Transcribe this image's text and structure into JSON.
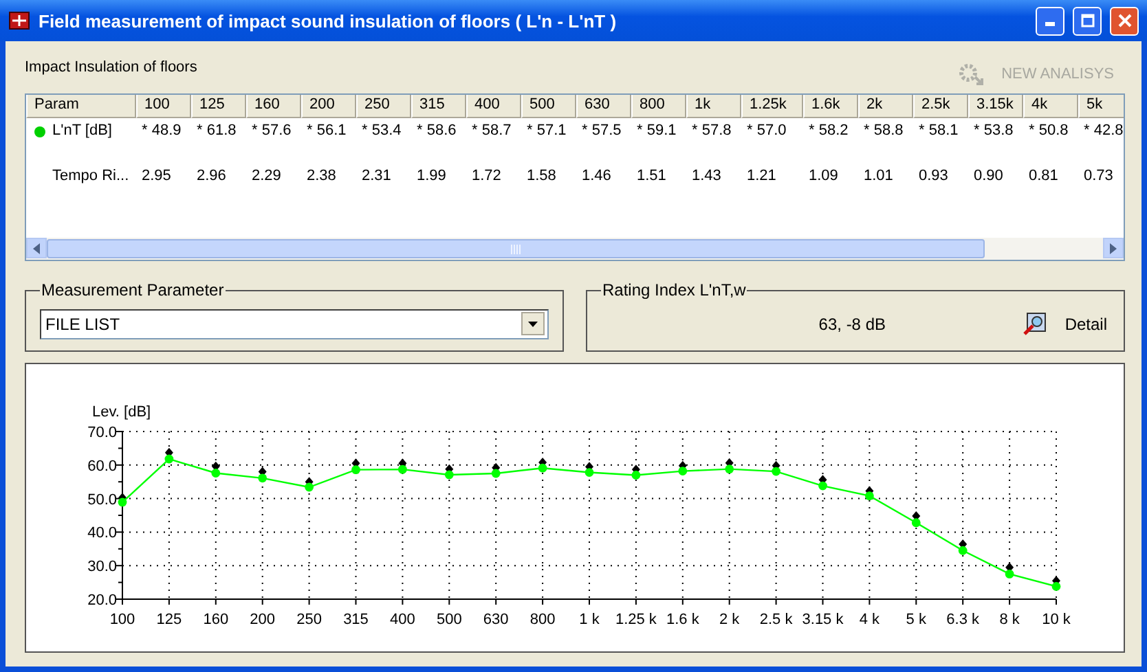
{
  "window": {
    "title": "Field measurement of impact sound insulation of floors ( L'n - L'nT )"
  },
  "section_title": "Impact Insulation of floors",
  "new_analysis_button": {
    "label": "NEW ANALISYS",
    "disabled": true
  },
  "table": {
    "columns": [
      "Param",
      "100",
      "125",
      "160",
      "200",
      "250",
      "315",
      "400",
      "500",
      "630",
      "800",
      "1k",
      "1.25k",
      "1.6k",
      "2k",
      "2.5k",
      "3.15k",
      "4k",
      "5k"
    ],
    "rows": [
      {
        "indicator": true,
        "cells": [
          "L'nT [dB]",
          "* 48.9",
          "* 61.8",
          "* 57.6",
          "* 56.1",
          "* 53.4",
          "* 58.6",
          "* 58.7",
          "* 57.1",
          "* 57.5",
          "* 59.1",
          "* 57.8",
          "* 57.0",
          "* 58.2",
          "* 58.8",
          "* 58.1",
          "* 53.8",
          "* 50.8",
          "* 42.8"
        ]
      },
      {
        "indicator": false,
        "cells": [
          "Tempo Ri...",
          "2.95",
          "2.96",
          "2.29",
          "2.38",
          "2.31",
          "1.99",
          "1.72",
          "1.58",
          "1.46",
          "1.51",
          "1.43",
          "1.21",
          "1.09",
          "1.01",
          "0.93",
          "0.90",
          "0.81",
          "0.73"
        ]
      }
    ]
  },
  "measurement_parameter": {
    "legend": "Measurement Parameter",
    "value": "FILE LIST"
  },
  "rating_index": {
    "legend": "Rating Index  L'nT,w",
    "value": "63, -8  dB",
    "detail_button": "Detail"
  },
  "chart": {
    "chart_data": {
      "type": "line",
      "ylabel": "Lev. [dB]",
      "categories": [
        "100",
        "125",
        "160",
        "200",
        "250",
        "315",
        "400",
        "500",
        "630",
        "800",
        "1 k",
        "1.25 k",
        "1.6 k",
        "2 k",
        "2.5 k",
        "3.15 k",
        "4 k",
        "5 k",
        "6.3 k",
        "8 k",
        "10 k"
      ],
      "ylim": [
        20,
        70
      ],
      "grid": true,
      "yticks": [
        {
          "value": 20,
          "label": "20.0"
        },
        {
          "value": 30,
          "label": "30.0"
        },
        {
          "value": 40,
          "label": "40.0"
        },
        {
          "value": 50,
          "label": "50.0"
        },
        {
          "value": 60,
          "label": "60.0"
        },
        {
          "value": 70,
          "label": "70.0"
        }
      ],
      "series": [
        {
          "type": "scatter",
          "marker": "diamond",
          "color": "#000000",
          "values": [
            50.3,
            63.7,
            59.6,
            58.0,
            55.0,
            60.5,
            60.5,
            58.8,
            59.2,
            60.8,
            59.5,
            58.7,
            59.8,
            60.6,
            59.8,
            55.6,
            52.3,
            44.8,
            36.4,
            29.5,
            25.5
          ]
        },
        {
          "type": "line",
          "marker": "circle",
          "color": "#00ff00",
          "values": [
            48.9,
            61.8,
            57.6,
            56.1,
            53.4,
            58.6,
            58.7,
            57.1,
            57.5,
            59.1,
            57.8,
            57.0,
            58.2,
            58.8,
            58.1,
            53.8,
            50.8,
            42.8,
            34.5,
            27.5,
            23.8
          ]
        }
      ]
    }
  }
}
